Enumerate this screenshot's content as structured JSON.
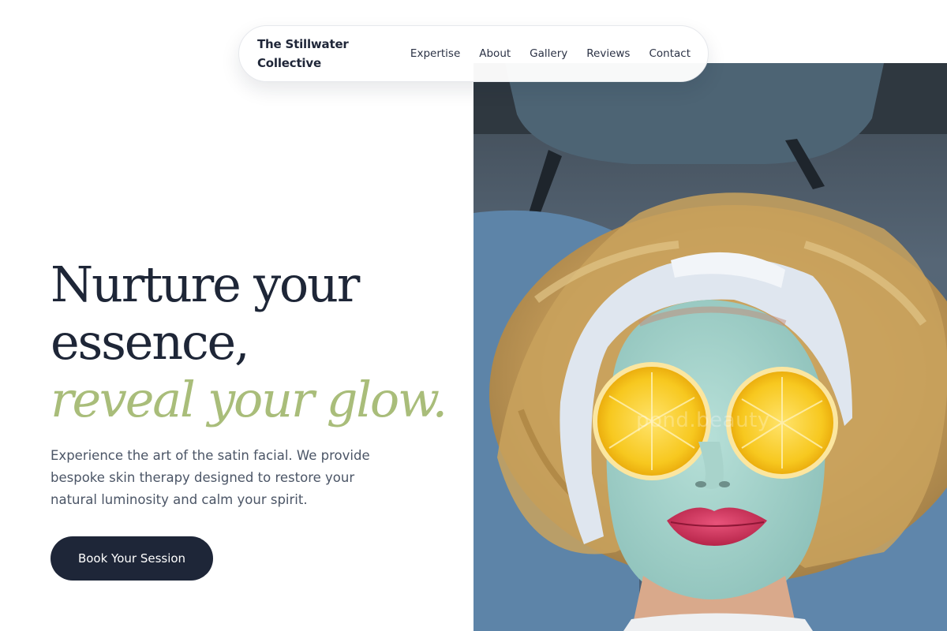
{
  "brand": {
    "line1": "The Stillwater",
    "line2": "Collective"
  },
  "nav": {
    "links": [
      "Expertise",
      "About",
      "Gallery",
      "Reviews",
      "Contact"
    ]
  },
  "hero": {
    "headline_line1": "Nurture your",
    "headline_line2": "essence,",
    "headline_accent": "reveal your glow.",
    "description": "Experience the art of the satin facial. We provide bespoke skin therapy designed to restore your natural luminosity and calm your spirit.",
    "cta_label": "Book Your Session",
    "image_watermark": "pond.beauty"
  },
  "colors": {
    "navy": "#1e2638",
    "accent_green": "#a9bd7a",
    "body_text": "#4b5566",
    "background": "#ffffff"
  }
}
